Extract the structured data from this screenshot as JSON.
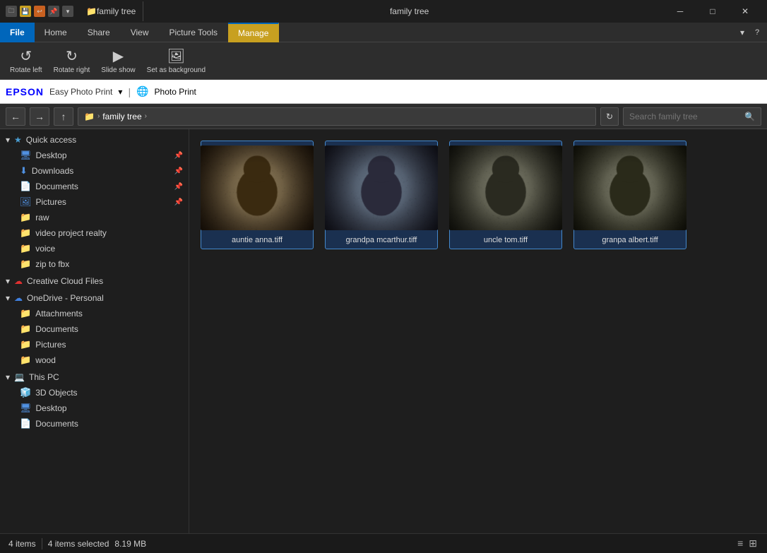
{
  "titlebar": {
    "title": "family tree",
    "window_icons": [
      "🗀",
      "📄",
      "💾",
      "📌"
    ],
    "controls": [
      "─",
      "□",
      "✕"
    ]
  },
  "ribbon_tabs": [
    {
      "label": "File",
      "type": "file"
    },
    {
      "label": "Home",
      "type": "normal"
    },
    {
      "label": "Share",
      "type": "normal"
    },
    {
      "label": "View",
      "type": "normal"
    },
    {
      "label": "Picture Tools",
      "type": "normal"
    },
    {
      "label": "Manage",
      "type": "manage"
    }
  ],
  "epson": {
    "brand": "EPSON",
    "easy_photo": "Easy Photo Print",
    "dropdown": "▾",
    "photo_print": "Photo Print"
  },
  "address": {
    "path_folder": "family tree",
    "search_placeholder": "Search family tree"
  },
  "sidebar": {
    "quick_access": "Quick access",
    "items_quick": [
      {
        "label": "Desktop",
        "pinned": true
      },
      {
        "label": "Downloads",
        "pinned": true
      },
      {
        "label": "Documents",
        "pinned": true
      },
      {
        "label": "Pictures",
        "pinned": true
      },
      {
        "label": "raw",
        "pinned": false
      },
      {
        "label": "video project realty",
        "pinned": false
      },
      {
        "label": "voice",
        "pinned": false
      },
      {
        "label": "zip to fbx",
        "pinned": false
      }
    ],
    "creative_cloud": "Creative Cloud Files",
    "onedrive": "OneDrive - Personal",
    "items_onedrive": [
      {
        "label": "Attachments"
      },
      {
        "label": "Documents"
      },
      {
        "label": "Pictures"
      },
      {
        "label": "wood"
      }
    ],
    "this_pc": "This PC",
    "items_thispc": [
      {
        "label": "3D Objects"
      },
      {
        "label": "Desktop"
      },
      {
        "label": "Documents"
      }
    ]
  },
  "files": [
    {
      "name": "auntie anna.tiff",
      "selected": true,
      "colors": [
        "#3a2a1a",
        "#5a4a2a",
        "#2a1a0a",
        "#4a3a1a",
        "#6a5a2a"
      ]
    },
    {
      "name": "grandpa mcarthur.tiff",
      "selected": true,
      "colors": [
        "#2a2a3a",
        "#4a4a5a",
        "#1a1a2a",
        "#3a3a4a",
        "#6a6a5a"
      ]
    },
    {
      "name": "uncle tom.tiff",
      "selected": true,
      "colors": [
        "#2a2a2a",
        "#4a4a3a",
        "#1a1a1a",
        "#3a3a2a",
        "#5a5a4a"
      ]
    },
    {
      "name": "granpa albert.tiff",
      "selected": true,
      "colors": [
        "#2a2a2a",
        "#3a3a2a",
        "#1a1a0a",
        "#4a4a3a",
        "#5a4a2a"
      ]
    }
  ],
  "status": {
    "count": "4 items",
    "selected": "4 items selected",
    "size": "8.19 MB"
  }
}
